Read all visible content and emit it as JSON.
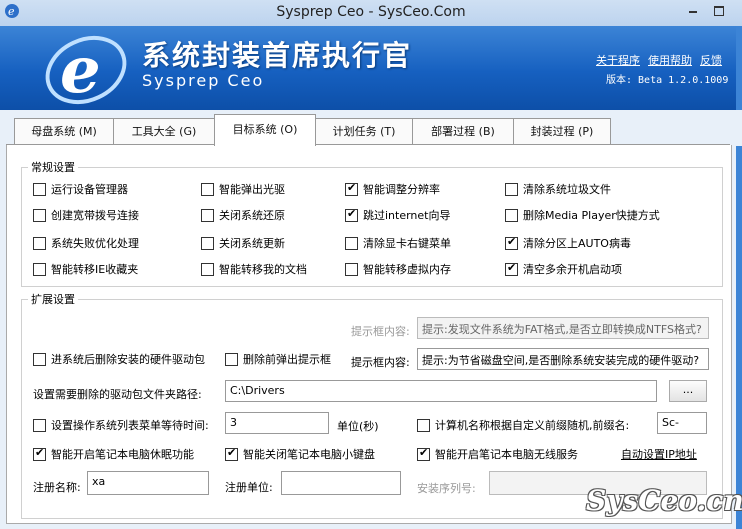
{
  "window": {
    "title": "Sysprep Ceo - SysCeo.Com"
  },
  "banner": {
    "cn_title": "系统封装首席执行官",
    "en_title": "Sysprep Ceo",
    "links": [
      "关于程序",
      "使用帮助",
      "反馈"
    ],
    "version": "版本: Beta 1.2.0.1009",
    "accent_color": "#1660c0"
  },
  "tabs": [
    {
      "label": "母盘系统 (M)"
    },
    {
      "label": "工具大全 (G)"
    },
    {
      "label": "目标系统 (O)",
      "active": true
    },
    {
      "label": "计划任务 (T)"
    },
    {
      "label": "部署过程 (B)"
    },
    {
      "label": "封装过程 (P)"
    }
  ],
  "general": {
    "title": "常规设置",
    "items": [
      {
        "label": "运行设备管理器",
        "checked": false
      },
      {
        "label": "智能弹出光驱",
        "checked": false
      },
      {
        "label": "智能调整分辨率",
        "checked": true
      },
      {
        "label": "清除系统垃圾文件",
        "checked": false
      },
      {
        "label": "创建宽带拨号连接",
        "checked": false
      },
      {
        "label": "关闭系统还原",
        "checked": false
      },
      {
        "label": "跳过internet向导",
        "checked": true
      },
      {
        "label": "删除Media Player快捷方式",
        "checked": false
      },
      {
        "label": "系统失败优化处理",
        "checked": false
      },
      {
        "label": "关闭系统更新",
        "checked": false
      },
      {
        "label": "清除显卡右键菜单",
        "checked": false
      },
      {
        "label": "清除分区上AUTO病毒",
        "checked": true
      },
      {
        "label": "智能转移IE收藏夹",
        "checked": false
      },
      {
        "label": "智能转移我的文档",
        "checked": false
      },
      {
        "label": "智能转移虚拟内存",
        "checked": false
      },
      {
        "label": "清空多余开机启动项",
        "checked": true
      }
    ]
  },
  "extended": {
    "title": "扩展设置",
    "prompt1_label": "提示框内容:",
    "prompt1_value": "提示:发现文件系统为FAT格式,是否立即转换成NTFS格式?",
    "delete_drivers_label": "进系统后删除安装的硬件驱动包",
    "delete_drivers_checked": false,
    "popup_before_delete_label": "删除前弹出提示框",
    "popup_before_delete_checked": false,
    "prompt2_label": "提示框内容:",
    "prompt2_value": "提示:为节省磁盘空间,是否删除系统安装完成的硬件驱动?",
    "driver_path_label": "设置需要删除的驱动包文件夹路径:",
    "driver_path_value": "C:\\Drivers",
    "browse_label": "...",
    "wait_time_label": "设置操作系统列表菜单等待时间:",
    "wait_time_checked": false,
    "wait_time_value": "3",
    "unit_label": "单位(秒)",
    "computer_name_label": "计算机名称根据自定义前缀随机,前缀名:",
    "computer_name_checked": false,
    "prefix_value": "Sc-",
    "hibernate_label": "智能开启笔记本电脑休眠功能",
    "hibernate_checked": true,
    "keyboard_label": "智能关闭笔记本电脑小键盘",
    "keyboard_checked": true,
    "wireless_label": "智能开启笔记本电脑无线服务",
    "wireless_checked": true,
    "auto_ip_link": "自动设置IP地址",
    "reg_name_label": "注册名称:",
    "reg_name_value": "xa",
    "reg_unit_label": "注册单位:",
    "reg_unit_value": "",
    "serial_label": "安装序列号:",
    "serial_value": ""
  },
  "watermark": "SysCeo.cn"
}
